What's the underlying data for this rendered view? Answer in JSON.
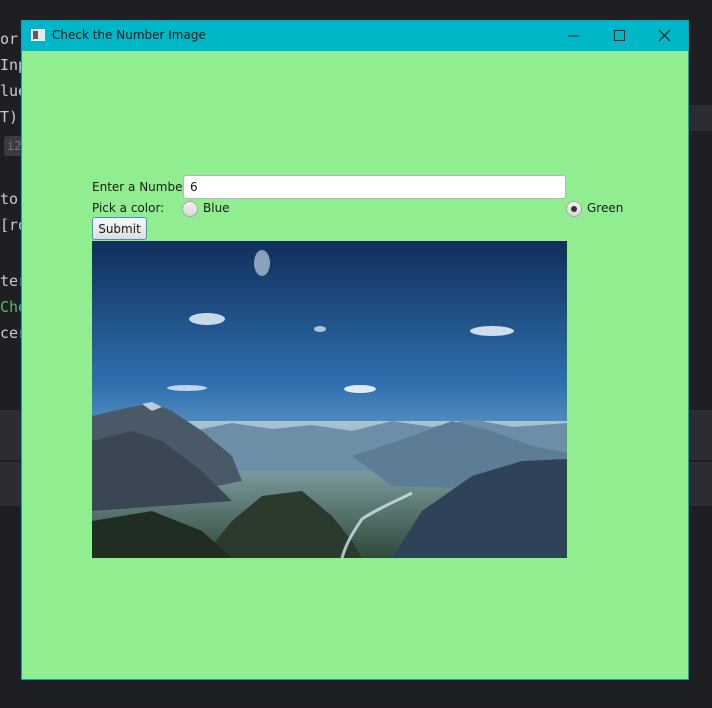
{
  "background_ide": {
    "lines": [
      "or",
      "Inp",
      "lue",
      "T);",
      "",
      "to",
      "[ro",
      "",
      "ter",
      "Che",
      "cer"
    ],
    "tag": "i2"
  },
  "window": {
    "title": "Check the Number Image",
    "background_color": "#90ee90",
    "titlebar_color": "#00b7c7"
  },
  "form": {
    "number_label": "Enter a Number:",
    "number_value": "6",
    "color_label": "Pick a color:",
    "options": [
      {
        "label": "Blue",
        "selected": false
      },
      {
        "label": "Green",
        "selected": true
      }
    ],
    "submit_label": "Submit"
  },
  "image": {
    "description_icon": "mountain-landscape-image"
  }
}
